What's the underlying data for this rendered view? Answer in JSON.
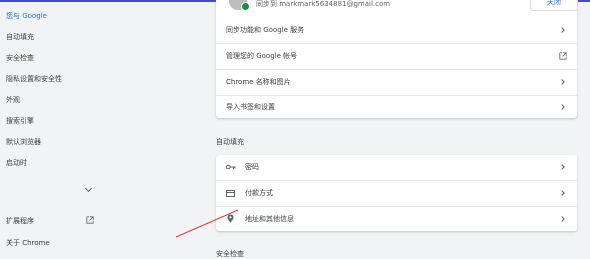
{
  "sidebar": {
    "items": [
      {
        "label": "您与 Google"
      },
      {
        "label": "自动填充"
      },
      {
        "label": "安全检查"
      },
      {
        "label": "隐私设置和安全性"
      },
      {
        "label": "外观"
      },
      {
        "label": "搜索引擎"
      },
      {
        "label": "默认浏览器"
      },
      {
        "label": "启动时"
      },
      {
        "label": "扩展程序"
      },
      {
        "label": "关于 Chrome"
      }
    ]
  },
  "you_and_google": {
    "email": "同步到 markmark5634881@gmail.com",
    "button_label": "关闭",
    "rows": [
      {
        "label": "同步功能和 Google 服务"
      },
      {
        "label": "管理您的 Google 帐号"
      },
      {
        "label": "Chrome 名称和图片"
      },
      {
        "label": "导入书签和设置"
      }
    ]
  },
  "autofill": {
    "title": "自动填充",
    "rows": [
      {
        "label": "密码",
        "icon": "key-icon"
      },
      {
        "label": "付款方式",
        "icon": "credit-card-icon"
      },
      {
        "label": "地址和其他信息",
        "icon": "location-pin-icon"
      }
    ]
  },
  "safety_check": {
    "title": "安全检查"
  },
  "colors": {
    "accent": "#1a73e8",
    "annotation": "#e53935"
  }
}
